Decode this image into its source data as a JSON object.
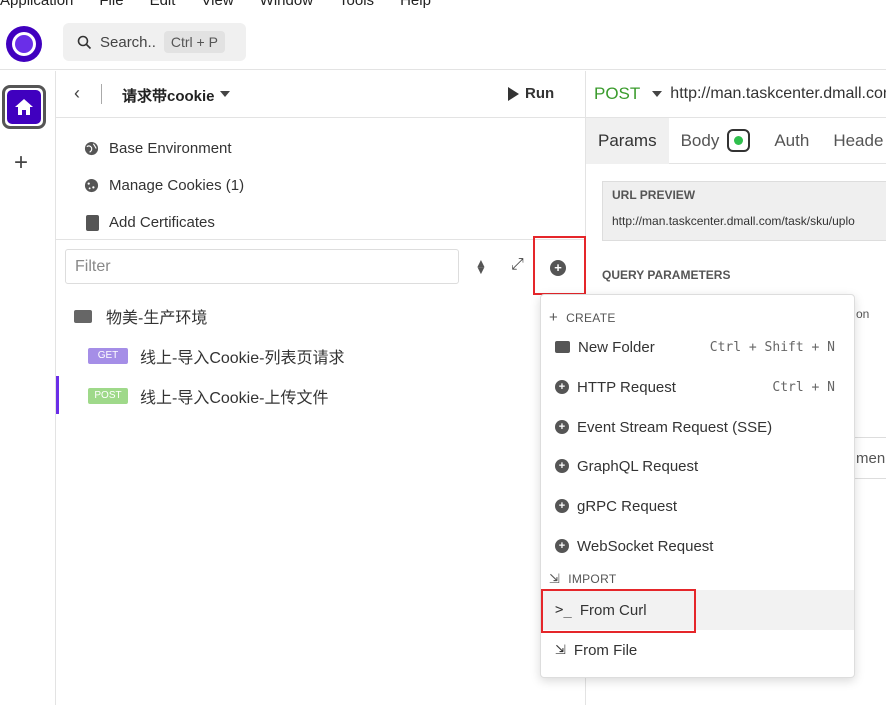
{
  "menubar": [
    "Application",
    "File",
    "Edit",
    "View",
    "Window",
    "Tools",
    "Help"
  ],
  "search": {
    "label": "Search..",
    "shortcut": "Ctrl + P"
  },
  "collection": {
    "name": "请求带cookie",
    "run_label": "Run"
  },
  "sidebar_links": [
    {
      "label": "Base Environment",
      "icon": "globe-icon"
    },
    {
      "label": "Manage Cookies (1)",
      "icon": "cookie-icon"
    },
    {
      "label": "Add Certificates",
      "icon": "certificate-icon"
    }
  ],
  "filter": {
    "placeholder": "Filter"
  },
  "tree": {
    "folder": "物美-生产环境",
    "requests": [
      {
        "method": "GET",
        "name": "线上-导入Cookie-列表页请求"
      },
      {
        "method": "POST",
        "name": "线上-导入Cookie-上传文件"
      }
    ]
  },
  "request": {
    "method": "POST",
    "url": "http://man.taskcenter.dmall.com"
  },
  "tabs": [
    "Params",
    "Body",
    "Auth",
    "Heade"
  ],
  "preview": {
    "title": "URL PREVIEW",
    "url": "http://man.taskcenter.dmall.com/task/sku/uplo"
  },
  "query_params_label": "QUERY PARAMETERS",
  "ghost_text": {
    "a": "on",
    "b": "men"
  },
  "dropdown": {
    "create_label": "CREATE",
    "create_items": [
      {
        "label": "New Folder",
        "shortcut": "Ctrl + Shift + N"
      },
      {
        "label": "HTTP Request",
        "shortcut": "Ctrl + N"
      },
      {
        "label": "Event Stream Request (SSE)",
        "shortcut": ""
      },
      {
        "label": "GraphQL Request",
        "shortcut": ""
      },
      {
        "label": "gRPC Request",
        "shortcut": ""
      },
      {
        "label": "WebSocket Request",
        "shortcut": ""
      }
    ],
    "import_label": "IMPORT",
    "import_items": [
      {
        "label": "From Curl"
      },
      {
        "label": "From File"
      }
    ]
  },
  "colors": {
    "brand": "#4000bf",
    "post": "#3a9b2c",
    "highlight_box": "#e5262a"
  }
}
